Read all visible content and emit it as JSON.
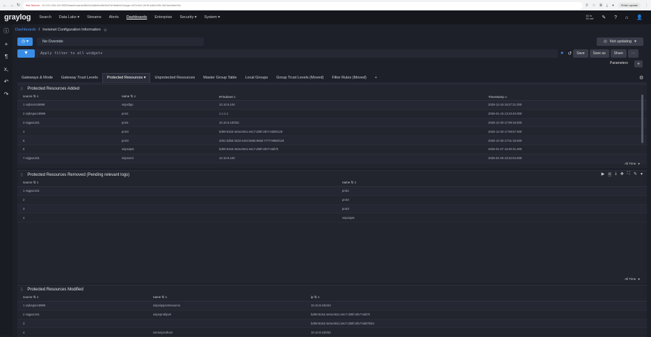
{
  "browser": {
    "security": "Not Secure",
    "url": "10.101.254.110:9000/dashboards/6643c0a5dbc0fe9bd7e0fadb6d?page=4f7e1fc0-2e9f-4a6f-b5f1-8b7aa2a0e0d1",
    "finish_update": "Finish update"
  },
  "nav": {
    "logo": "graylog",
    "items": [
      "Search",
      "Data Lake ▾",
      "Streams",
      "Alerts",
      "Dashboards",
      "Enterprise",
      "Security ▾",
      "System ▾"
    ],
    "in_rate": "16 in",
    "out_rate": "16 out"
  },
  "sidebar_icons": [
    "info-icon",
    "plus-icon",
    "paragraph-icon",
    "x-icon",
    "undo-icon",
    "redo-icon"
  ],
  "breadcrumb": {
    "root": "Dashboards",
    "sep": "/",
    "title": "Invisinet Configuration Information"
  },
  "query": {
    "override": "No Override",
    "not_updating": "Not updating"
  },
  "filter": {
    "placeholder": "Apply filter to all widgets",
    "save": "Save",
    "save_as": "Save as",
    "share": "Share",
    "more": "···",
    "parameters": "Parameters"
  },
  "tabs": [
    {
      "label": "Gateways & Mode",
      "active": false
    },
    {
      "label": "Gateway Trust Levels",
      "active": false
    },
    {
      "label": "Protected Resources ▾",
      "active": true
    },
    {
      "label": "Unprotected Resources",
      "active": false
    },
    {
      "label": "Master Group Table",
      "active": false
    },
    {
      "label": "Local Groups",
      "active": false
    },
    {
      "label": "Group Trust Levels (Moved)",
      "active": false
    },
    {
      "label": "Filter Rules (Moved)",
      "active": false
    },
    {
      "label": "+",
      "active": false
    }
  ],
  "widget1": {
    "title": "Protected Resources Added",
    "columns": [
      "source",
      "name",
      "IP/Subnet",
      "TimeStamp"
    ],
    "rows": [
      [
        "1  ssjh4srs18999",
        "ssipsfigs",
        "10.10.9.104",
        "2025-12-16 16:27:21.000"
      ],
      [
        "2  ssjh4gsv18999",
        "prot1",
        "1.1.1.1",
        "2026-01-15 13:23:40.000"
      ],
      [
        "3  ssjgw1431",
        "prot1",
        "10.10.9.100/32",
        "2025-12-30 17:09:19.000"
      ],
      [
        "4",
        "prot3",
        "bd09:8153:4e0a:5911:e6c7:d39f:c0b7:0dd6/128",
        "2025-12-30 17:09:57.000"
      ],
      [
        "5",
        "prot3",
        "2001:0db8:3333:4444:5555:6666:7777:8888/128",
        "2025-12-30 17:01:19.000"
      ],
      [
        "6",
        "ssipsiqs6",
        "bd09:8153:4e0a:5911:e6c7:d39f:c0b7:0dd7k",
        "2026-01-07 16:30:31.000"
      ],
      [
        "7  ssjgw1431",
        "ssipsnmt",
        "10.10.9.100",
        "2026-01-05 10:22:04.000"
      ]
    ],
    "range": "All Time"
  },
  "widget2": {
    "title": "Protected Resources Removed (Pending relevant logs)",
    "columns": [
      "source",
      "name"
    ],
    "rows": [
      [
        "1  ssjgw1431",
        "prot1"
      ],
      [
        "2",
        "prot3"
      ],
      [
        "3",
        "prot3"
      ],
      [
        "4",
        "ssipsiqs6"
      ]
    ],
    "range": "All Time"
  },
  "widget3": {
    "title": "Protected Resources Modified",
    "columns": [
      "source",
      "name",
      "ip"
    ],
    "rows": [
      [
        "1  ssjh4gsv18999",
        "ssipsiqsprotresource",
        "10.10.9.194/24"
      ],
      [
        "2  ssjgw1431",
        "ssipsprotlipvh",
        "bd09:8153:4e0a:5911:e6c7:d39f:c0b7:0dd7k"
      ],
      [
        "3",
        "",
        "bd09:8153:4e0a:5911:e6c7:d39f:c0b7:0dd7k/64"
      ],
      [
        "4",
        "ssmsnprothost",
        "10.10.9.100/32"
      ]
    ]
  },
  "colors": {
    "accent": "#3a8de6",
    "background": "#1e2029",
    "panel": "#22242e",
    "navbar": "#15171d"
  }
}
